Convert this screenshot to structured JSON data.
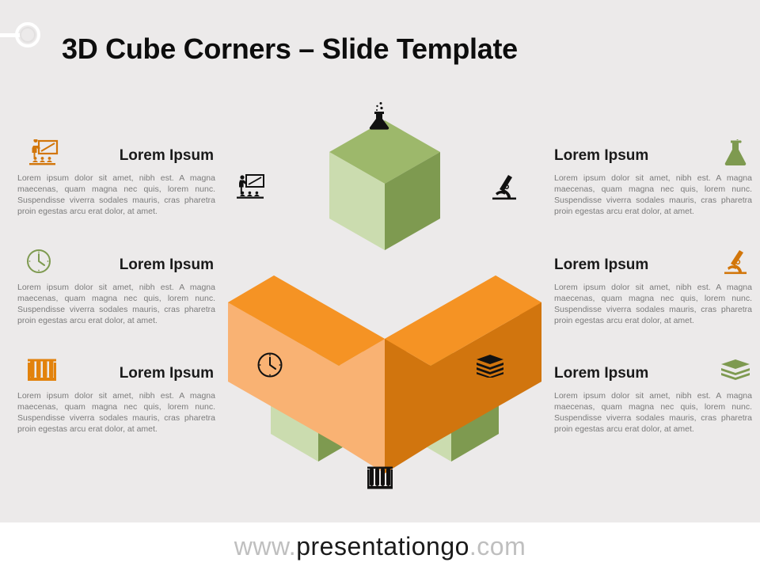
{
  "header": {
    "title": "3D Cube Corners – Slide Template",
    "pin_icon": "circle-pin-icon"
  },
  "blocks": {
    "left": [
      {
        "icon": "presentation-training-icon",
        "icon_color": "#D2760A",
        "heading": "Lorem Ipsum",
        "body": "Lorem ipsum dolor sit amet, nibh est. A magna maecenas, quam magna nec quis, lorem nunc. Suspendisse viverra sodales mauris, cras pharetra proin egestas arcu erat dolor, at amet."
      },
      {
        "icon": "clock-icon",
        "icon_color": "#7E9A50",
        "heading": "Lorem Ipsum",
        "body": "Lorem ipsum dolor sit amet, nibh est. A magna maecenas, quam magna nec quis, lorem nunc. Suspendisse viverra sodales mauris, cras pharetra proin egestas arcu erat dolor, at amet."
      },
      {
        "icon": "test-tubes-icon",
        "icon_color": "#E2820C",
        "heading": "Lorem Ipsum",
        "body": "Lorem ipsum dolor sit amet, nibh est. A magna maecenas, quam magna nec quis, lorem nunc. Suspendisse viverra sodales mauris, cras pharetra proin egestas arcu erat dolor, at amet."
      }
    ],
    "right": [
      {
        "icon": "flask-icon",
        "icon_color": "#7E9A50",
        "heading": "Lorem Ipsum",
        "body": "Lorem ipsum dolor sit amet, nibh est. A magna maecenas, quam magna nec quis, lorem nunc. Suspendisse viverra sodales mauris, cras pharetra proin egestas arcu erat dolor, at amet."
      },
      {
        "icon": "microscope-icon",
        "icon_color": "#D2760A",
        "heading": "Lorem Ipsum",
        "body": "Lorem ipsum dolor sit amet, nibh est. A magna maecenas, quam magna nec quis, lorem nunc. Suspendisse viverra sodales mauris, cras pharetra proin egestas arcu erat dolor, at amet."
      },
      {
        "icon": "books-stack-icon",
        "icon_color": "#7E9A50",
        "heading": "Lorem Ipsum",
        "body": "Lorem ipsum dolor sit amet, nibh est. A magna maecenas, quam magna nec quis, lorem nunc. Suspendisse viverra sodales mauris, cras pharetra proin egestas arcu erat dolor, at amet."
      }
    ]
  },
  "diagram": {
    "name": "3d-cube-corners-isometric-diagram",
    "colors": {
      "background": "#ECEAEA",
      "orange_top": "#F59324",
      "orange_left": "#F9B273",
      "orange_right": "#D1750E",
      "green_top": "#9DB86B",
      "green_left": "#CBDCAF",
      "green_right": "#7E9A50"
    },
    "floating_icons": [
      "flask-icon",
      "presentation-training-icon",
      "microscope-icon",
      "clock-icon",
      "books-stack-icon",
      "test-tubes-icon"
    ]
  },
  "footer": {
    "url_prefix": "www.",
    "url_brand": "presentationgo",
    "url_suffix": ".com"
  }
}
